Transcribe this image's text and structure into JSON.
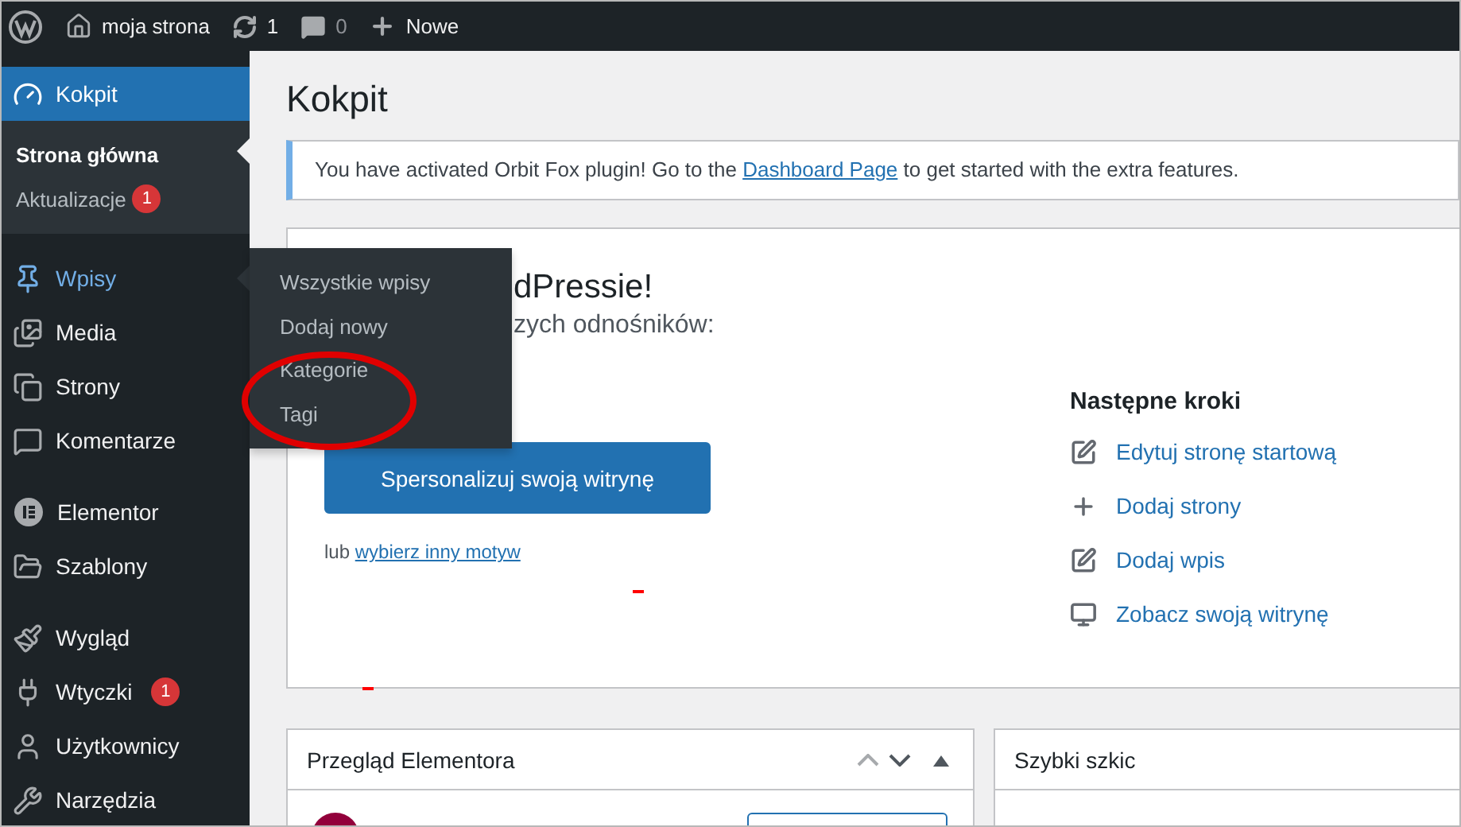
{
  "top_bar": {
    "site_name": "moja strona",
    "updates_count": "1",
    "comments_count": "0",
    "new_label": "Nowe"
  },
  "sidebar": {
    "menu_groups": [
      {
        "items": [
          {
            "label": "Kokpit",
            "selected": true,
            "expanded": false,
            "submenu": [
              {
                "label": "Strona główna",
                "selected": true
              },
              {
                "label": "Aktualizacje",
                "selected": false,
                "badge": "1"
              }
            ]
          }
        ]
      },
      {
        "items": [
          {
            "label": "Wpisy",
            "selected": false,
            "expanded": true,
            "submenu": [
              {
                "label": "Wszystkie wpisy",
                "selected": false
              },
              {
                "label": "Dodaj nowy",
                "selected": false
              },
              {
                "label": "Kategorie",
                "selected": false
              },
              {
                "label": "Tagi",
                "selected": false
              }
            ]
          },
          {
            "label": "Media",
            "selected": false,
            "expanded": false
          },
          {
            "label": "Strony",
            "selected": false,
            "expanded": false
          },
          {
            "label": "Komentarze",
            "selected": false,
            "expanded": false
          }
        ]
      },
      {
        "items": [
          {
            "label": "Elementor",
            "selected": false,
            "expanded": false
          },
          {
            "label": "Szablony",
            "selected": false,
            "expanded": false
          }
        ]
      },
      {
        "items": [
          {
            "label": "Wygląd",
            "selected": false,
            "expanded": false
          },
          {
            "label": "Wtyczki",
            "selected": false,
            "expanded": false,
            "badge": "1"
          },
          {
            "label": "Użytkownicy",
            "selected": false,
            "expanded": false
          },
          {
            "label": "Narzędzia",
            "selected": false,
            "expanded": false
          }
        ]
      }
    ]
  },
  "page_title": "Kokpit",
  "notice": {
    "text_before": "You have activated Orbit Fox plugin! Go to the ",
    "link": "Dashboard Page",
    "text_after": " to get started with the extra features."
  },
  "welcome_panel": {
    "heading": "dPressie!",
    "subheading": "zych odnośników:",
    "button": "Spersonalizuj swoją witrynę",
    "alt_prefix": "lub ",
    "alt_link": "wybierz inny motyw",
    "next_steps": {
      "title": "Następne kroki",
      "links": [
        "Edytuj stronę startową",
        "Dodaj strony",
        "Dodaj wpis",
        "Zobacz swoją witrynę"
      ]
    }
  },
  "widgets": [
    {
      "title": "Przegląd Elementora",
      "kind": "overview"
    },
    {
      "title": "Szybki szkic",
      "kind": "draft"
    }
  ]
}
